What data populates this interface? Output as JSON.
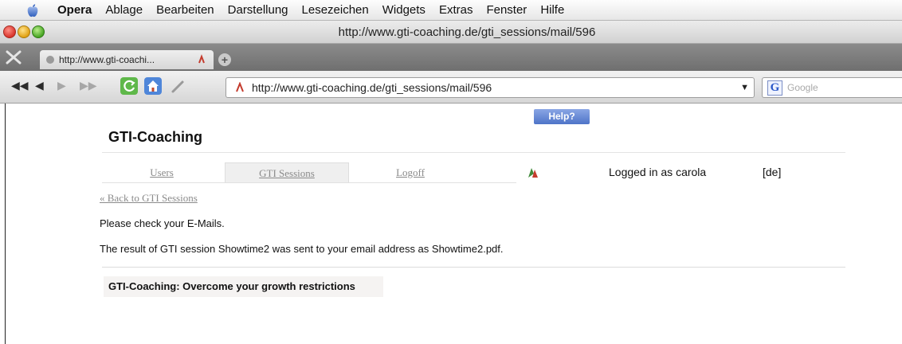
{
  "menubar": {
    "items": [
      "Opera",
      "Ablage",
      "Bearbeiten",
      "Darstellung",
      "Lesezeichen",
      "Widgets",
      "Extras",
      "Fenster",
      "Hilfe"
    ]
  },
  "window": {
    "title": "http://www.gti-coaching.de/gti_sessions/mail/596"
  },
  "tab": {
    "title": "http://www.gti-coachi..."
  },
  "toolbar": {
    "address": "http://www.gti-coaching.de/gti_sessions/mail/596",
    "search_placeholder": "Google"
  },
  "page": {
    "help_label": "Help?",
    "site_title": "GTI-Coaching",
    "nav": {
      "users": "Users",
      "gti_sessions": "GTI Sessions",
      "logoff": "Logoff"
    },
    "logged_in": "Logged in as carola",
    "language": "[de]",
    "back_link": "« Back to GTI Sessions",
    "message_check": "Please check your E-Mails.",
    "message_result": "The result of GTI session Showtime2 was sent to your email address as Showtime2.pdf.",
    "footer": "GTI-Coaching: Overcome your growth restrictions"
  }
}
